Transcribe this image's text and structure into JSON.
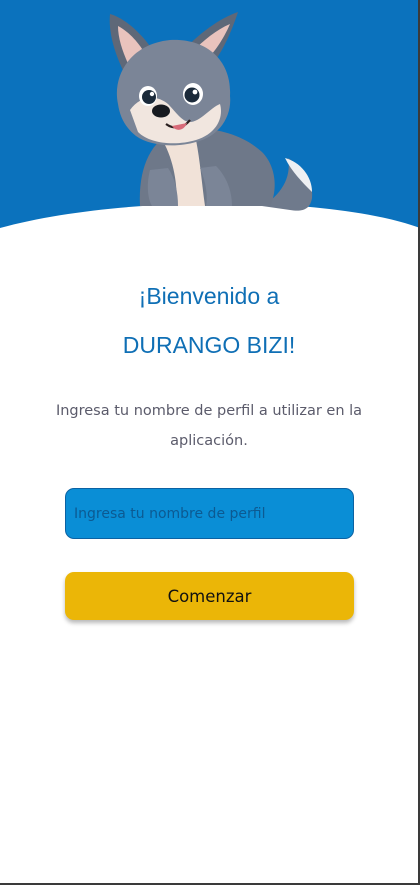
{
  "header": {
    "mascot_icon": "wolf-mascot-icon",
    "background_color": "#0b72bd"
  },
  "welcome": {
    "title_line1": "¡Bienvenido a",
    "title_line2": "DURANGO BIZI!",
    "subtitle": "Ingresa tu nombre de perfil a utilizar en la aplicación."
  },
  "profile_form": {
    "input_value": "",
    "input_placeholder": "Ingresa tu nombre de perfil",
    "start_button_label": "Comenzar",
    "input_color": "#0a8ed6",
    "button_color": "#ebb607",
    "title_color": "#0f6fb5"
  }
}
